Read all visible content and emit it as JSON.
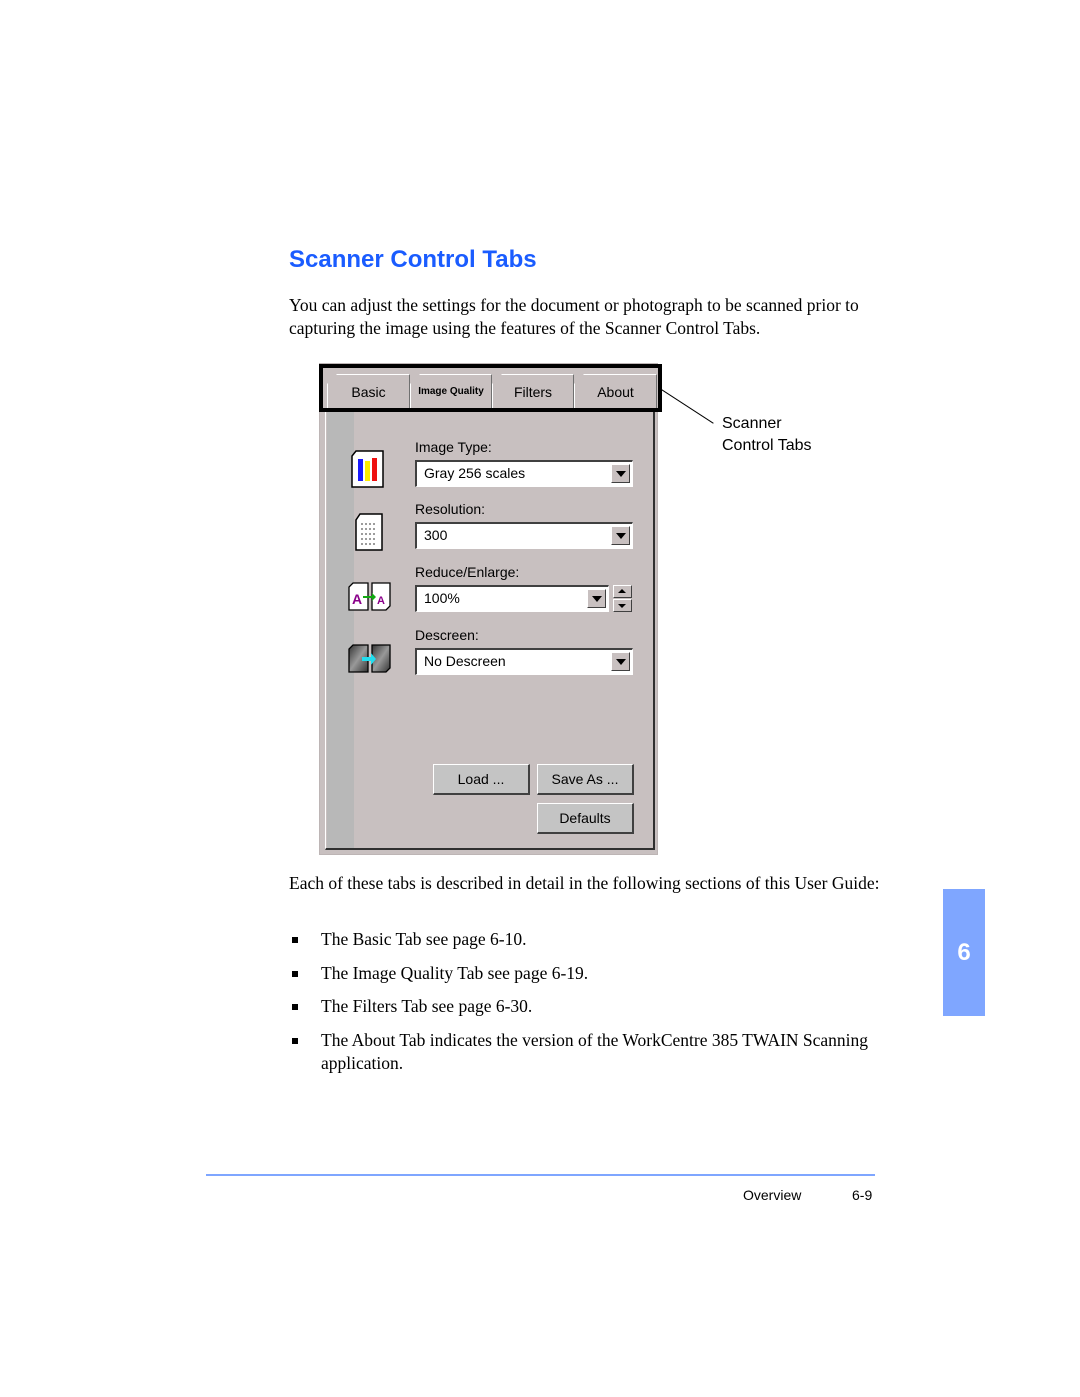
{
  "heading": "Scanner Control Tabs",
  "intro": "You can adjust the settings for the document or photograph to be scanned prior to capturing the image using the features of the Scanner Control Tabs.",
  "dialog": {
    "tabs": [
      {
        "label": "Basic"
      },
      {
        "label": "Image Quality"
      },
      {
        "label": "Filters"
      },
      {
        "label": "About"
      }
    ],
    "image_type": {
      "label": "Image Type:",
      "value": "Gray 256 scales"
    },
    "resolution": {
      "label": "Resolution:",
      "value": "300"
    },
    "reduce_enlarge": {
      "label": "Reduce/Enlarge:",
      "value": "100%"
    },
    "descreen": {
      "label": "Descreen:",
      "value": "No Descreen"
    },
    "buttons": {
      "load": "Load ...",
      "save_as": "Save As ...",
      "defaults": "Defaults"
    },
    "icons": {
      "image_type": "color-bars-icon",
      "resolution": "dotted-page-icon",
      "reduce_enlarge": "resize-pages-icon",
      "descreen": "descreen-pages-icon"
    }
  },
  "callout": {
    "line1": "Scanner",
    "line2": "Control Tabs"
  },
  "body_text": "Each of these tabs is described in detail in the following sections of this User Guide:",
  "bullets": [
    "The Basic Tab see page 6-10.",
    "The Image Quality Tab see page 6-19.",
    "The Filters Tab see page 6-30.",
    "The About Tab indicates the version of the WorkCentre 385 TWAIN Scanning application."
  ],
  "chapter_tab": "6",
  "footer": {
    "section": "Overview",
    "page": "6-9"
  },
  "colors": {
    "heading": "#1a5cff",
    "accent": "#7fa6ff",
    "dialog_bg": "#c8c0c0"
  }
}
